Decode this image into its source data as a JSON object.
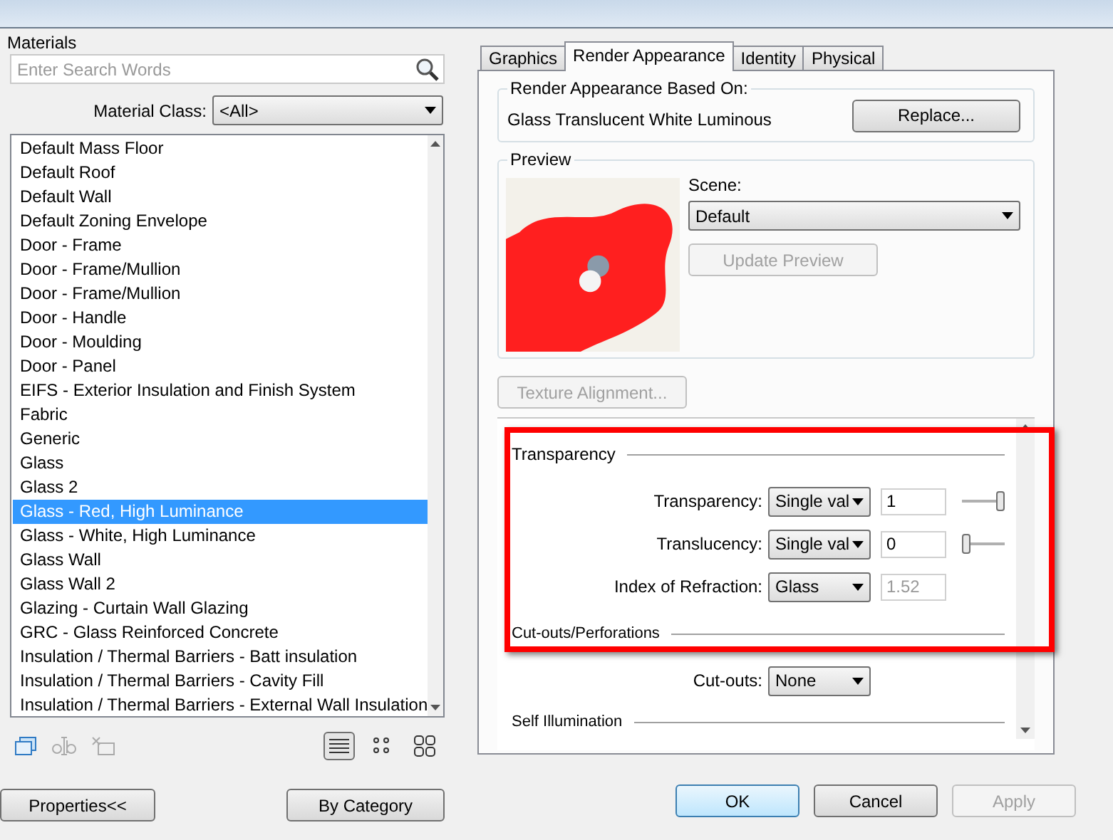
{
  "materials_panel": {
    "title": "Materials",
    "search": {
      "placeholder": "Enter Search Words"
    },
    "material_class": {
      "label": "Material Class:",
      "value": "<All>"
    },
    "items": [
      {
        "label": "Default Mass Floor",
        "selected": false
      },
      {
        "label": "Default Roof",
        "selected": false
      },
      {
        "label": "Default Wall",
        "selected": false
      },
      {
        "label": "Default Zoning Envelope",
        "selected": false
      },
      {
        "label": "Door - Frame",
        "selected": false
      },
      {
        "label": "Door - Frame/Mullion",
        "selected": false
      },
      {
        "label": "Door - Frame/Mullion",
        "selected": false
      },
      {
        "label": "Door - Handle",
        "selected": false
      },
      {
        "label": "Door - Moulding",
        "selected": false
      },
      {
        "label": "Door - Panel",
        "selected": false
      },
      {
        "label": "EIFS - Exterior Insulation and Finish System",
        "selected": false
      },
      {
        "label": "Fabric",
        "selected": false
      },
      {
        "label": "Generic",
        "selected": false
      },
      {
        "label": "Glass",
        "selected": false
      },
      {
        "label": "Glass 2",
        "selected": false
      },
      {
        "label": "Glass - Red, High Luminance",
        "selected": true
      },
      {
        "label": "Glass - White, High Luminance",
        "selected": false
      },
      {
        "label": "Glass Wall",
        "selected": false
      },
      {
        "label": "Glass Wall 2",
        "selected": false
      },
      {
        "label": "Glazing - Curtain Wall Glazing",
        "selected": false
      },
      {
        "label": "GRC - Glass Reinforced Concrete",
        "selected": false
      },
      {
        "label": "Insulation / Thermal Barriers - Batt insulation",
        "selected": false
      },
      {
        "label": "Insulation / Thermal Barriers - Cavity Fill",
        "selected": false
      },
      {
        "label": "Insulation / Thermal Barriers - External Wall Insulation",
        "selected": false
      }
    ],
    "view_modes": [
      {
        "kind": "list",
        "selected": true
      },
      {
        "kind": "small",
        "selected": false
      },
      {
        "kind": "large",
        "selected": false
      }
    ]
  },
  "tabs": [
    {
      "label": "Graphics",
      "selected": false
    },
    {
      "label": "Render Appearance",
      "selected": true
    },
    {
      "label": "Identity",
      "selected": false
    },
    {
      "label": "Physical",
      "selected": false
    }
  ],
  "render_appearance": {
    "legend": "Render Appearance Based On:",
    "value": "Glass Translucent White Luminous",
    "replace_button": "Replace..."
  },
  "preview": {
    "legend": "Preview",
    "scene_label": "Scene:",
    "scene_value": "Default",
    "update_button": {
      "label": "Update Preview",
      "disabled": true
    }
  },
  "texture_button": {
    "label": "Texture Alignment...",
    "disabled": true
  },
  "transparency": {
    "title": "Transparency",
    "highlighted": true,
    "rows": [
      {
        "kind": "slider",
        "label": "Transparency:",
        "mode": "Single val",
        "value": "1",
        "level": 1
      },
      {
        "kind": "slider",
        "label": "Translucency:",
        "mode": "Single val",
        "value": "0",
        "level": 0
      },
      {
        "kind": "fixed",
        "label": "Index of Refraction:",
        "mode": "Glass",
        "value": "1.52",
        "disabled": true
      }
    ]
  },
  "cutouts": {
    "title": "Cut-outs/Perforations",
    "label": "Cut-outs:",
    "value": "None"
  },
  "self_illumination": {
    "title": "Self Illumination"
  },
  "left_buttons": [
    {
      "label": "Properties<<"
    },
    {
      "label": "By Category"
    }
  ],
  "right_buttons": [
    {
      "label": "OK",
      "default": true,
      "disabled": false
    },
    {
      "label": "Cancel",
      "default": false,
      "disabled": false
    },
    {
      "label": "Apply",
      "default": false,
      "disabled": true
    }
  ]
}
